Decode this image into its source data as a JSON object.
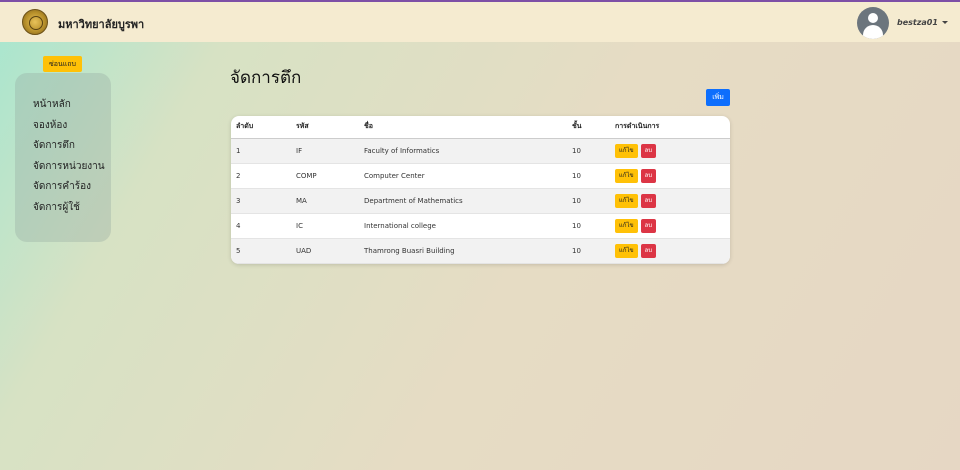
{
  "header": {
    "brand": "มหาวิทยาลัยบูรพา",
    "username": "bestza01"
  },
  "sidebar": {
    "toggle_label": "ซ่อนแถบ",
    "items": [
      {
        "label": "หน้าหลัก"
      },
      {
        "label": "จองห้อง"
      },
      {
        "label": "จัดการตึก"
      },
      {
        "label": "จัดการหน่วยงาน"
      },
      {
        "label": "จัดการคำร้อง"
      },
      {
        "label": "จัดการผู้ใช้"
      }
    ]
  },
  "main": {
    "title": "จัดการตึก",
    "add_label": "เพิ่ม",
    "columns": [
      "ลำดับ",
      "รหัส",
      "ชื่อ",
      "ชั้น",
      "การดำเนินการ"
    ],
    "rows": [
      {
        "no": "1",
        "code": "IF",
        "name": "Faculty of Informatics",
        "floors": "10"
      },
      {
        "no": "2",
        "code": "COMP",
        "name": "Computer Center",
        "floors": "10"
      },
      {
        "no": "3",
        "code": "MA",
        "name": "Department of Mathematics",
        "floors": "10"
      },
      {
        "no": "4",
        "code": "IC",
        "name": "International college",
        "floors": "10"
      },
      {
        "no": "5",
        "code": "UAD",
        "name": "Thamrong Buasri Building",
        "floors": "10"
      }
    ],
    "edit_label": "แก้ไข",
    "delete_label": "ลบ"
  },
  "colors": {
    "accent": "#0d6efd",
    "warning": "#ffc107",
    "danger": "#dc3545",
    "topbar_border": "#7d4fa6"
  }
}
